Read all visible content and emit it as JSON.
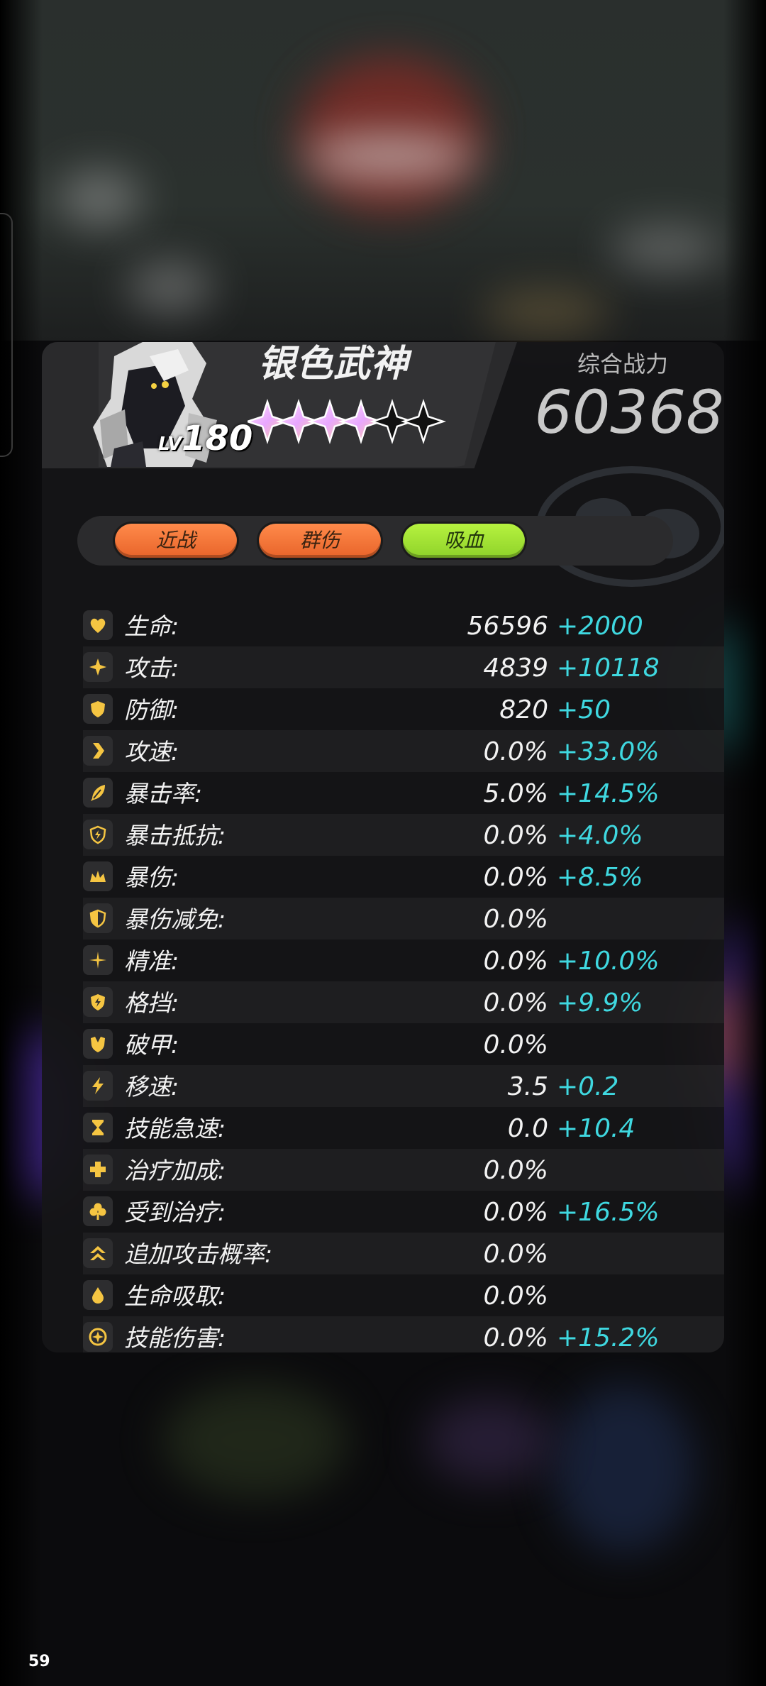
{
  "hero": {
    "name": "银色武神",
    "level_label": "LV",
    "level": "180",
    "stars_filled": 4,
    "stars_total": 6
  },
  "power": {
    "label": "综合战力",
    "value": "60368"
  },
  "tags": [
    "近战",
    "群伤",
    "吸血"
  ],
  "colors": {
    "bonus": "#3fd8e0",
    "icon_gold": "#f5c542",
    "tag_orange": "#f07535",
    "tag_green": "#a6e636"
  },
  "stats": [
    {
      "name": "生命:",
      "base": "56596",
      "bonus": "+2000",
      "icon": "heart-icon"
    },
    {
      "name": "攻击:",
      "base": "4839",
      "bonus": "+10118",
      "icon": "sparkle-icon"
    },
    {
      "name": "防御:",
      "base": "820",
      "bonus": "+50",
      "icon": "shield-icon"
    },
    {
      "name": "攻速:",
      "base": "0.0%",
      "bonus": "+33.0%",
      "icon": "chevron-right-icon"
    },
    {
      "name": "暴击率:",
      "base": "5.0%",
      "bonus": "+14.5%",
      "icon": "feather-icon"
    },
    {
      "name": "暴击抵抗:",
      "base": "0.0%",
      "bonus": "+4.0%",
      "icon": "shield-lightning-icon"
    },
    {
      "name": "暴伤:",
      "base": "0.0%",
      "bonus": "+8.5%",
      "icon": "crown-icon"
    },
    {
      "name": "暴伤减免:",
      "base": "0.0%",
      "bonus": "",
      "icon": "shield-half-icon"
    },
    {
      "name": "精准:",
      "base": "0.0%",
      "bonus": "+10.0%",
      "icon": "crosshair-icon"
    },
    {
      "name": "格挡:",
      "base": "0.0%",
      "bonus": "+9.9%",
      "icon": "shield-bolt-icon"
    },
    {
      "name": "破甲:",
      "base": "0.0%",
      "bonus": "",
      "icon": "broken-shield-icon"
    },
    {
      "name": "移速:",
      "base": "3.5",
      "bonus": "+0.2",
      "icon": "lightning-icon"
    },
    {
      "name": "技能急速:",
      "base": "0.0",
      "bonus": "+10.4",
      "icon": "hourglass-icon"
    },
    {
      "name": "治疗加成:",
      "base": "0.0%",
      "bonus": "",
      "icon": "plus-icon"
    },
    {
      "name": "受到治疗:",
      "base": "0.0%",
      "bonus": "+16.5%",
      "icon": "clover-icon"
    },
    {
      "name": "追加攻击概率:",
      "base": "0.0%",
      "bonus": "",
      "icon": "double-chevron-up-icon"
    },
    {
      "name": "生命吸取:",
      "base": "0.0%",
      "bonus": "",
      "icon": "drop-icon"
    },
    {
      "name": "技能伤害:",
      "base": "0.0%",
      "bonus": "+15.2%",
      "icon": "star-burst-icon"
    }
  ],
  "fps": "59"
}
